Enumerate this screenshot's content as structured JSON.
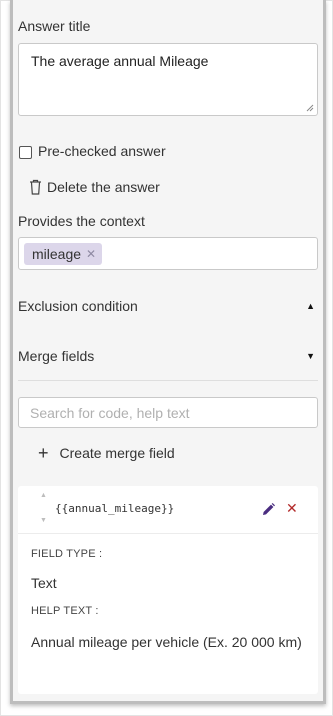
{
  "answer": {
    "title_label": "Answer title",
    "title_value": "The average annual Mileage",
    "prechecked_label": "Pre-checked answer",
    "prechecked": false,
    "delete_label": "Delete the answer"
  },
  "context": {
    "label": "Provides the context",
    "tags": [
      "mileage"
    ]
  },
  "sections": {
    "exclusion_label": "Exclusion condition",
    "exclusion_state": "expanded",
    "merge_label": "Merge fields",
    "merge_state": "collapsed"
  },
  "search": {
    "placeholder": "Search for code, help text"
  },
  "create": {
    "label": "Create merge field"
  },
  "merge_field": {
    "code": "{{annual_mileage}}",
    "field_type_label": "FIELD TYPE :",
    "field_type_value": "Text",
    "help_text_label": "HELP TEXT :",
    "help_text_value": "Annual mileage per vehicle (Ex. 20 000 km)"
  },
  "icons": {
    "trash": "trash-icon",
    "remove_tag": "close-icon",
    "caret_up": "caret-up-icon",
    "caret_down": "caret-down-icon",
    "plus": "plus-icon",
    "edit": "pencil-icon",
    "remove": "close-icon",
    "drag": "drag-handle-icon"
  },
  "colors": {
    "panel_bg": "#f5f5f5",
    "tag_bg": "#dcd6ea",
    "edit_icon": "#4a2d80",
    "remove_icon": "#b22a2a"
  }
}
